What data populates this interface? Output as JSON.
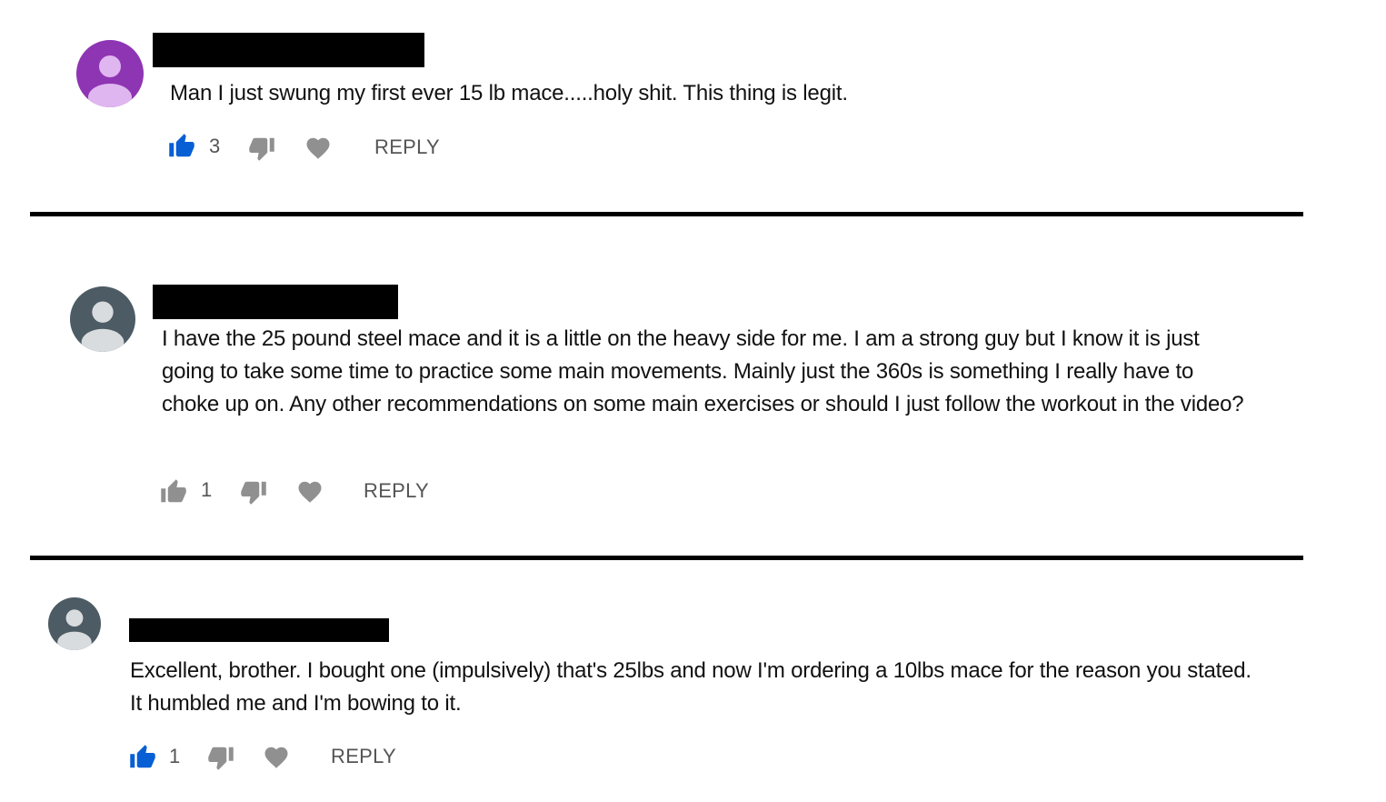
{
  "colors": {
    "liked_blue": "#065fd4",
    "icon_gray": "#909090",
    "avatar_purple": "#8e35b3",
    "avatar_purple_figure": "#e0b6f0",
    "avatar_slate": "#4c5b64",
    "avatar_slate_figure": "#d9dcde",
    "redaction": "#000000"
  },
  "comments": [
    {
      "avatar_icon": "person-silhouette-icon",
      "text": "Man I just swung my first ever 15 lb mace.....holy shit. This thing is legit.",
      "like_count": "3",
      "liked": true,
      "reply_label": "REPLY"
    },
    {
      "avatar_icon": "person-silhouette-icon",
      "text": "I have the 25 pound steel mace and it is a little on the heavy side for me. I am a strong guy but I know it is just going to take some time to practice some main movements. Mainly just the 360s is something I really have to choke up on. Any other recommendations on some main exercises or should I just follow the workout in the video?",
      "like_count": "1",
      "liked": false,
      "reply_label": "REPLY"
    },
    {
      "avatar_icon": "person-silhouette-icon",
      "text": "Excellent, brother. I bought one (impulsively) that's 25lbs and now I'm ordering a 10lbs mace for the reason you stated. It humbled me and I'm bowing to it.",
      "like_count": "1",
      "liked": true,
      "reply_label": "REPLY"
    }
  ]
}
